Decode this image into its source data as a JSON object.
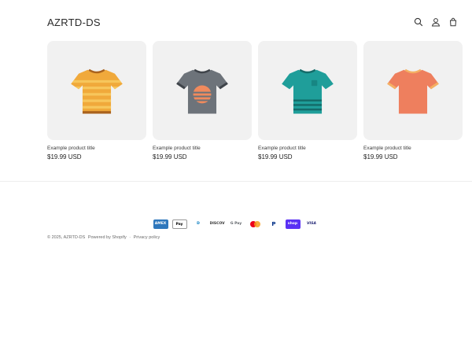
{
  "header": {
    "brand": "AZRTD-DS",
    "icons": [
      "search-icon",
      "account-icon",
      "cart-icon"
    ]
  },
  "products": [
    {
      "title": "Example product title",
      "price": "$19.99 USD",
      "image": "yellow-striped-tshirt"
    },
    {
      "title": "Example product title",
      "price": "$19.99 USD",
      "image": "gray-sunset-tshirt"
    },
    {
      "title": "Example product title",
      "price": "$19.99 USD",
      "image": "teal-striped-tshirt"
    },
    {
      "title": "Example product title",
      "price": "$19.99 USD",
      "image": "coral-tshirt"
    }
  ],
  "payment_methods": [
    "AMEX",
    "Pay",
    "D",
    "DISCOVER",
    "G Pay",
    "mastercard",
    "P",
    "shop",
    "VISA"
  ],
  "footer": {
    "copyright": "© 2025, AZRTD-DS",
    "powered_by": "Powered by Shopify",
    "separator": "·",
    "privacy": "Privacy policy"
  },
  "colors": {
    "thumb_bg": "#f1f1f1",
    "text": "#1f1f1f"
  }
}
